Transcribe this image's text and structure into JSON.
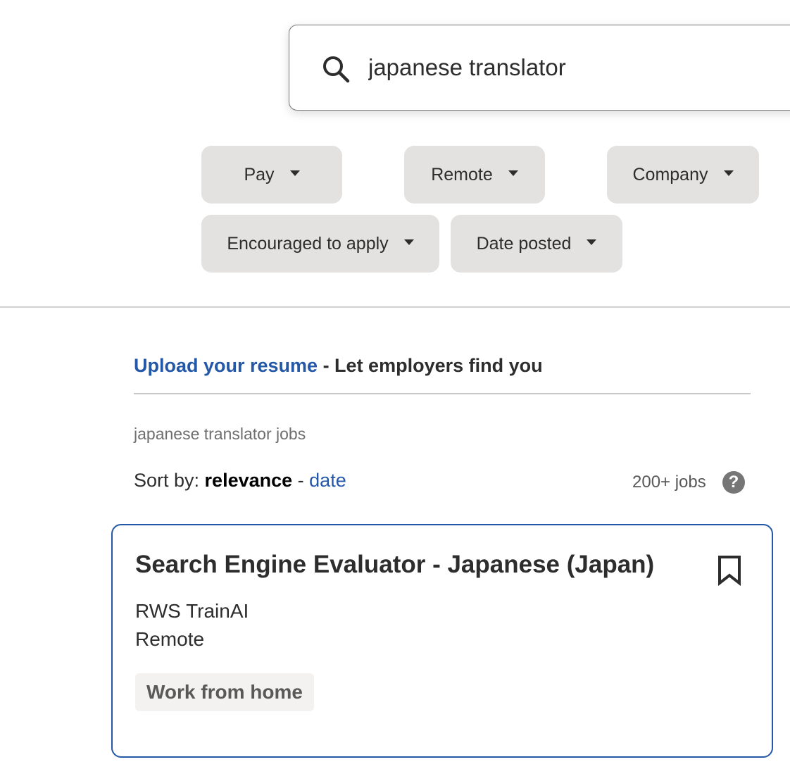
{
  "search": {
    "value": "japanese translator",
    "icon": "search-icon"
  },
  "filters": {
    "pay": "Pay",
    "remote": "Remote",
    "company": "Company",
    "encouraged": "Encouraged to apply",
    "date_posted": "Date posted"
  },
  "resume_banner": {
    "link_text": "Upload your resume",
    "rest_text": " - Let employers find you"
  },
  "results": {
    "heading": "japanese translator jobs",
    "sort_label": "Sort by: ",
    "sort_active": "relevance",
    "sort_separator": " - ",
    "sort_alt": "date",
    "count": "200+ jobs",
    "help_symbol": "?"
  },
  "job_card": {
    "title": "Search Engine Evaluator - Japanese (Japan)",
    "company": "RWS TrainAI",
    "location": "Remote",
    "tag": "Work from home"
  },
  "colors": {
    "link": "#2557a7",
    "pill_bg": "#e4e2e0",
    "card_border": "#2557a7"
  }
}
